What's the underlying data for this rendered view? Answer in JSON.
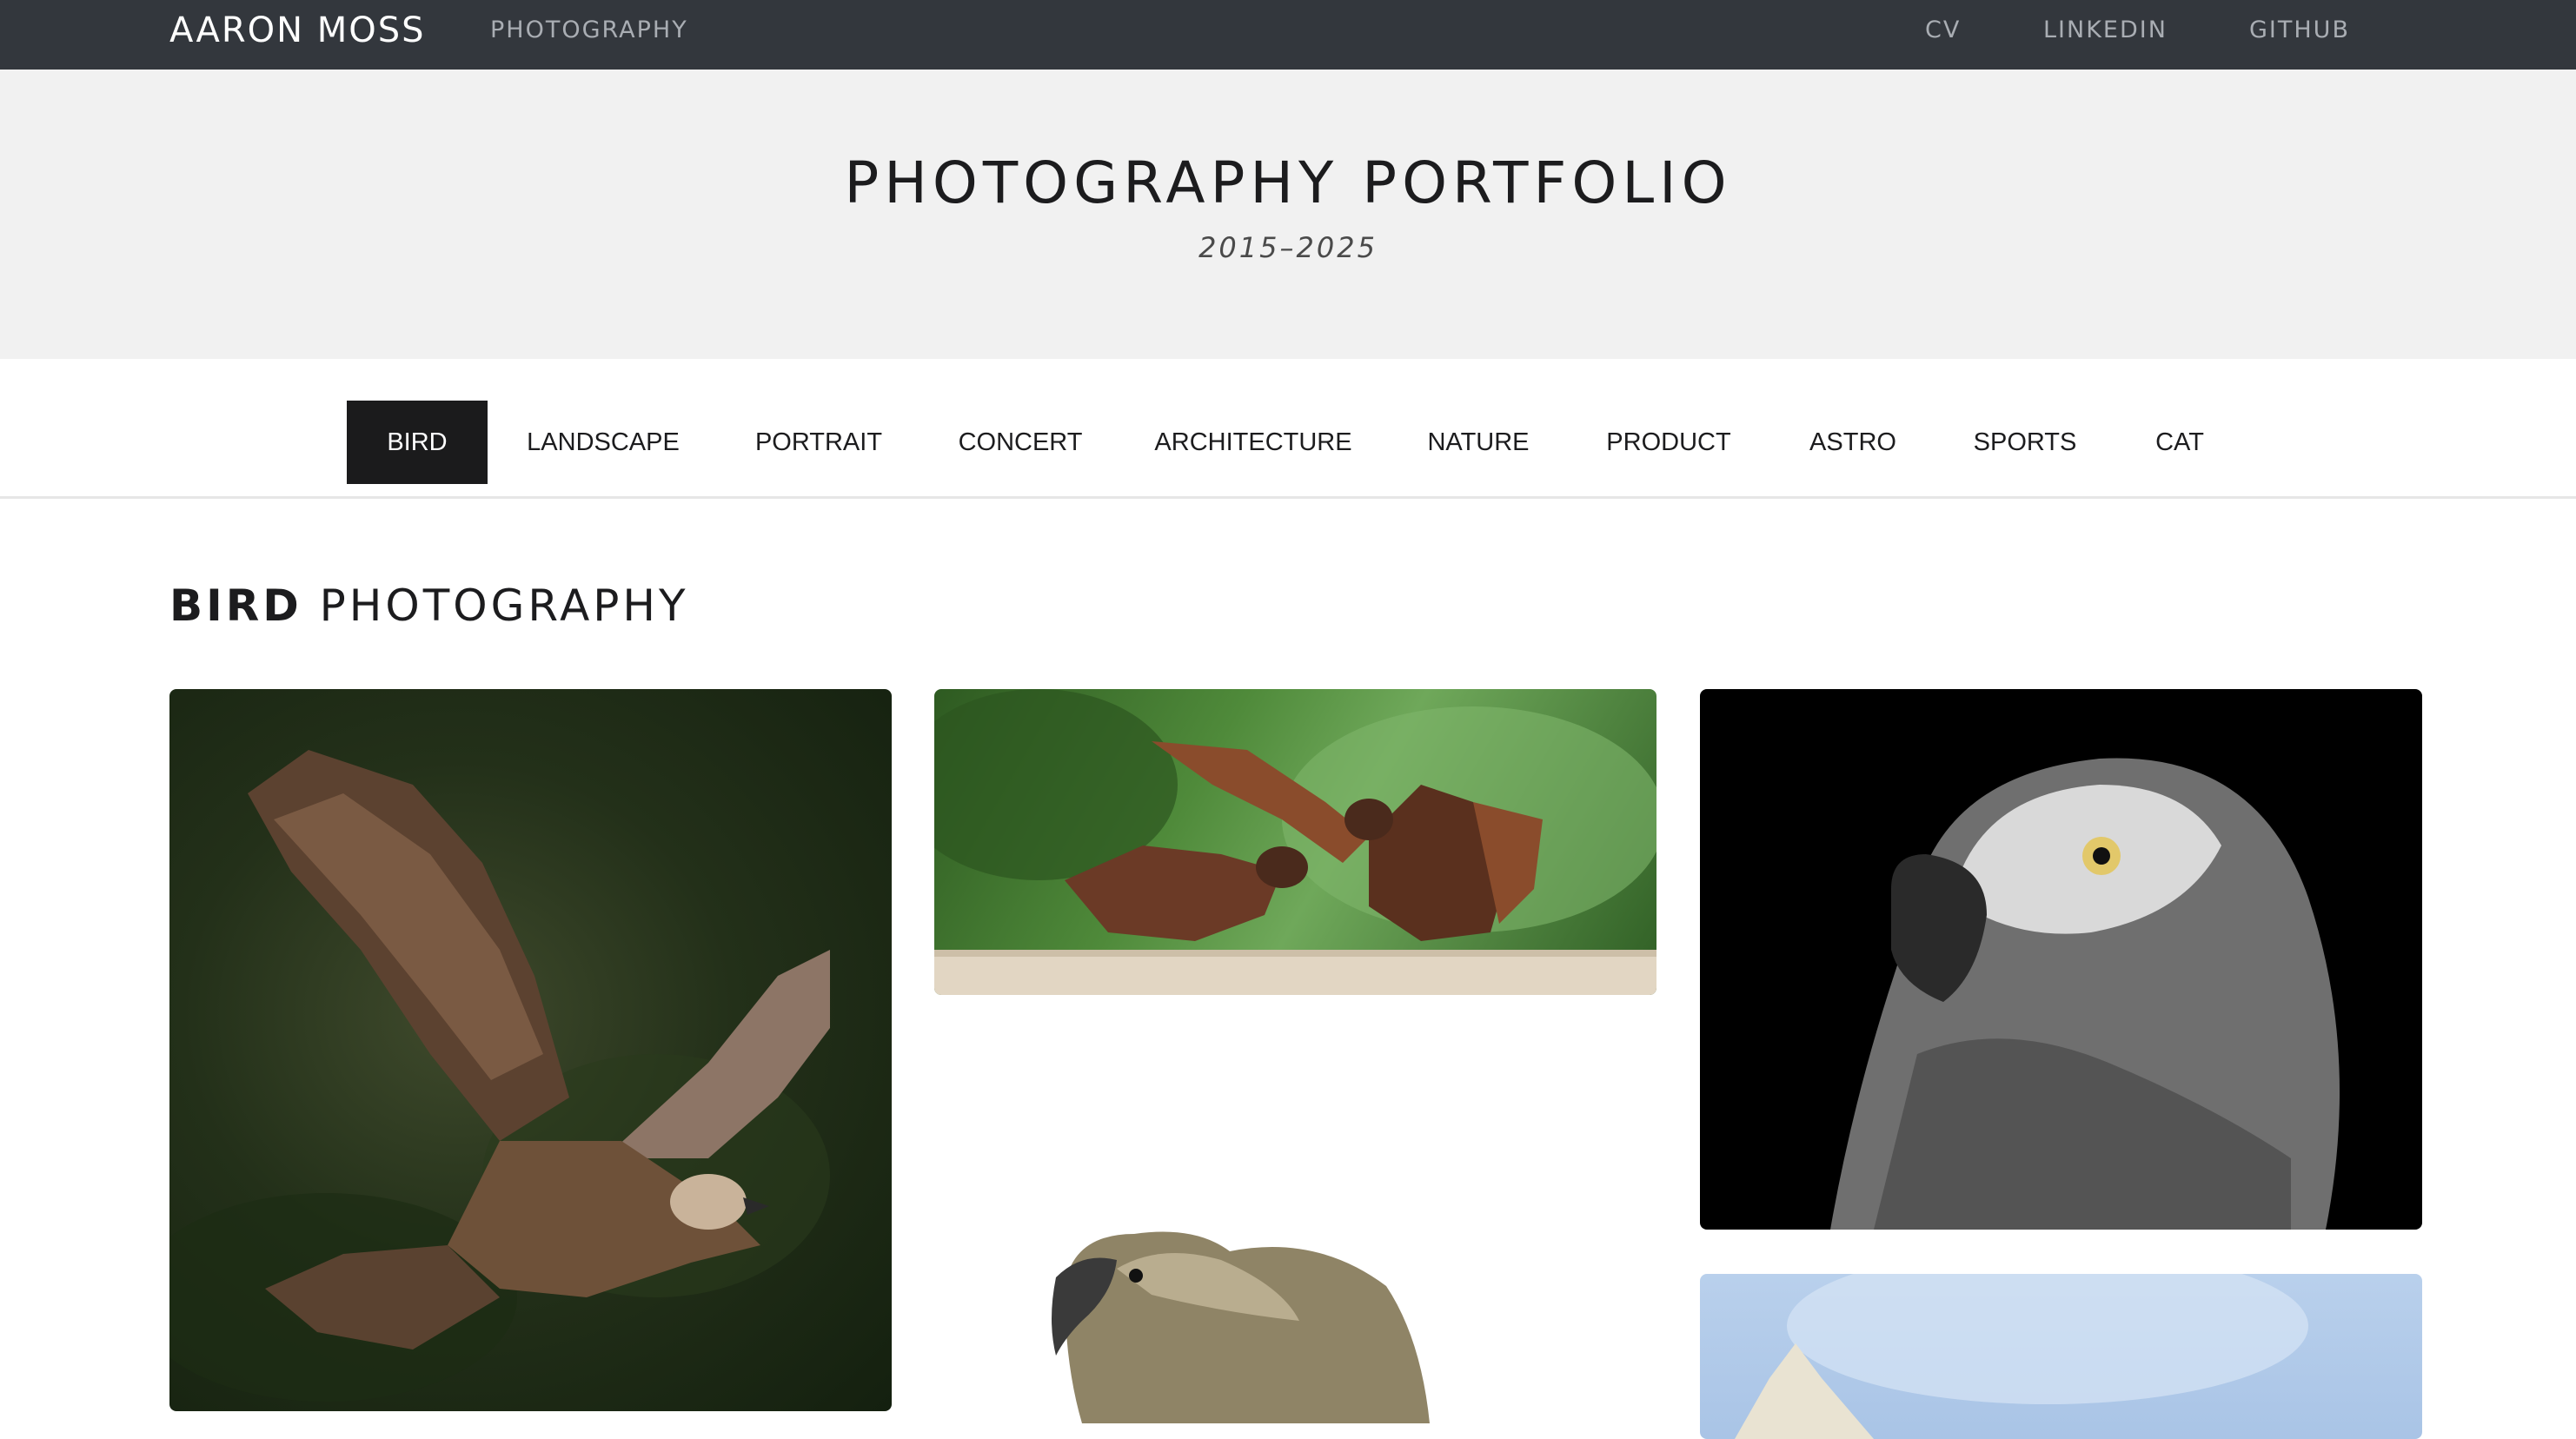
{
  "navbar": {
    "brand": "AARON MOSS",
    "section": "PHOTOGRAPHY",
    "links": [
      "CV",
      "LINKEDIN",
      "GITHUB"
    ]
  },
  "hero": {
    "title_strong": "PHOTOGRAPHY",
    "title_rest": " PORTFOLIO",
    "subtitle": "2015–2025"
  },
  "tabs": [
    "BIRD",
    "LANDSCAPE",
    "PORTRAIT",
    "CONCERT",
    "ARCHITECTURE",
    "NATURE",
    "PRODUCT",
    "ASTRO",
    "SPORTS",
    "CAT"
  ],
  "active_tab": "BIRD",
  "section": {
    "heading_bold": "BIRD",
    "heading_rest": " PHOTOGRAPHY"
  },
  "gallery": [
    {
      "subject": "kite in flight",
      "background": "dark forest green"
    },
    {
      "subject": "two kaka birds on a railing",
      "background": "tree ferns"
    },
    {
      "subject": "grey parrot portrait",
      "background": "black"
    },
    {
      "subject": "kea head",
      "background": "white"
    },
    {
      "subject": "bird wing",
      "background": "blue sky"
    }
  ],
  "colors": {
    "navbar": "#33373d",
    "hero": "#f1f1f1",
    "active_tab": "#1b1b1c",
    "text": "#1c1c1e"
  }
}
